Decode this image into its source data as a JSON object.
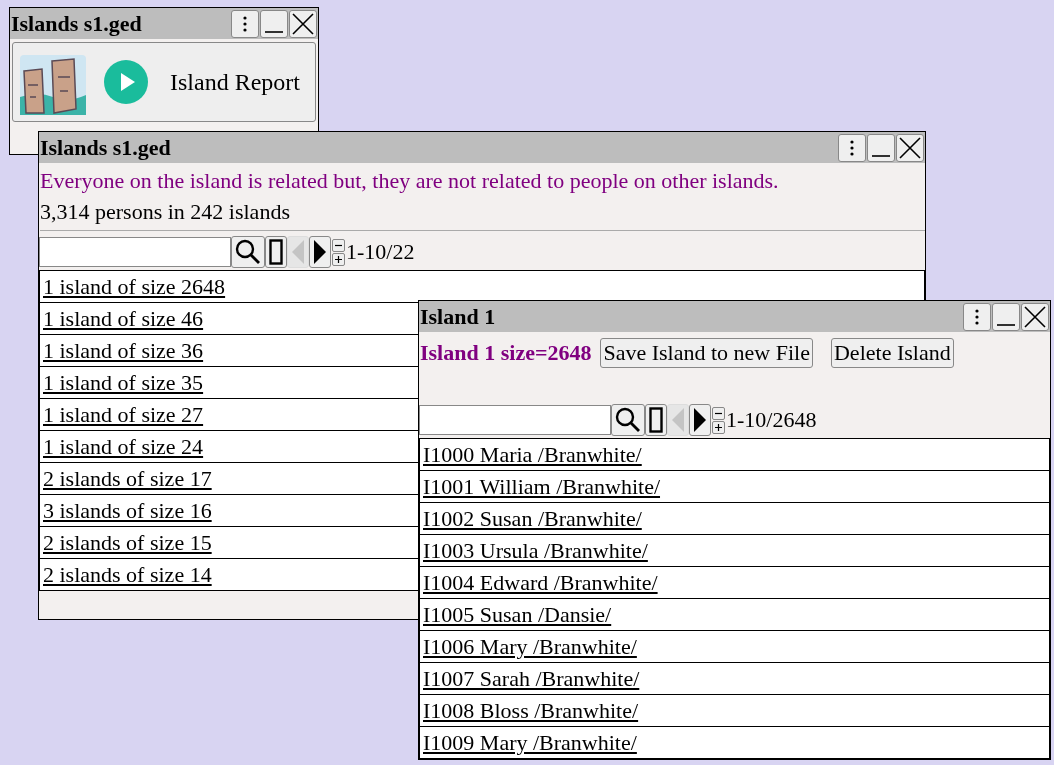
{
  "windows": [
    {
      "kind": "launcher",
      "title": "Islands s1.ged",
      "report": {
        "label": "Island Report"
      }
    },
    {
      "kind": "list",
      "title": "Islands s1.ged",
      "description": "Everyone on the island is related but, they are not related to people on other islands.",
      "summary": "3,314 persons in 242 islands",
      "pager": {
        "range": "1-10/22",
        "prev_disabled": true,
        "next_disabled": false
      },
      "rows": [
        "1 island of size 2648",
        "1 island of size 46",
        "1 island of size 36",
        "1 island of size 35",
        "1 island of size 27",
        "1 island of size 24",
        "2 islands of size 17",
        "3 islands of size 16",
        "2 islands of size 15",
        "2 islands of size 14"
      ]
    },
    {
      "kind": "detail",
      "title": "Island 1",
      "heading": "Island 1 size=2648",
      "buttons": [
        "Save Island to new File",
        "Delete Island"
      ],
      "pager": {
        "range": "1-10/2648",
        "prev_disabled": true,
        "next_disabled": false
      },
      "rows": [
        "I1000 Maria /Branwhite/",
        "I1001 William /Branwhite/",
        "I1002 Susan /Branwhite/",
        "I1003 Ursula /Branwhite/",
        "I1004 Edward /Branwhite/",
        "I1005 Susan /Dansie/",
        "I1006 Mary /Branwhite/",
        "I1007 Sarah /Branwhite/",
        "I1008 Bloss /Branwhite/",
        "I1009 Mary /Branwhite/"
      ]
    }
  ]
}
